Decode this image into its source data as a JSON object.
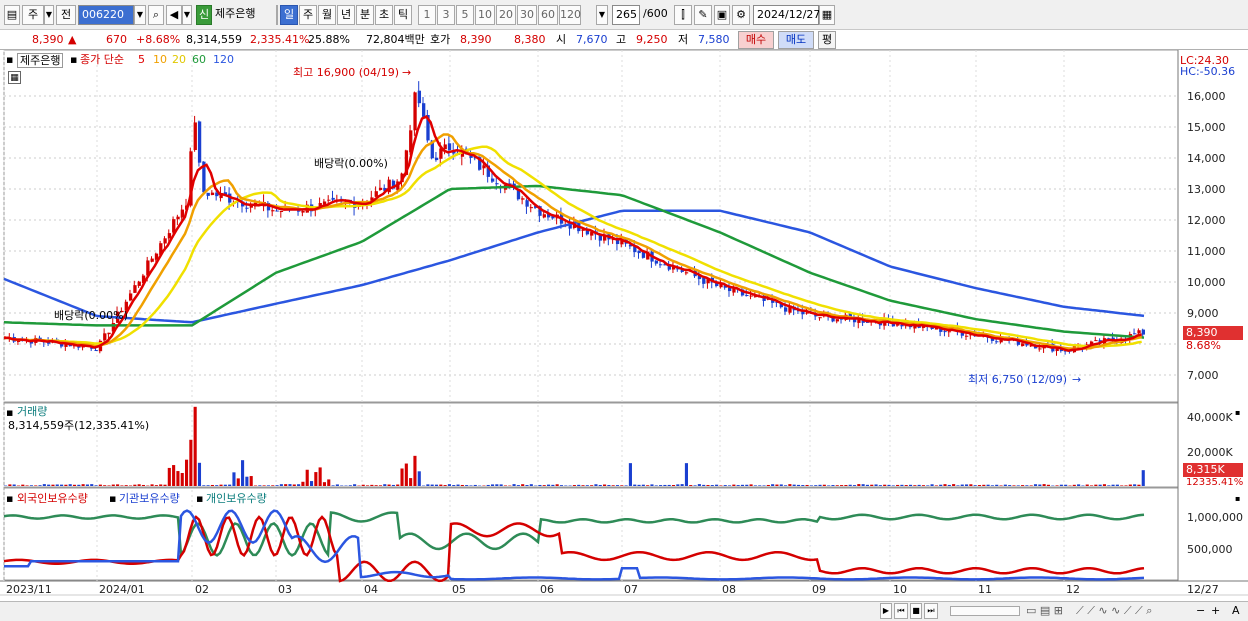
{
  "toolbar": {
    "type_label": "주",
    "prev_label": "전",
    "stock_code": "006220",
    "badge": "신",
    "stock_name": "제주은행",
    "periods": [
      "일",
      "주",
      "월",
      "년",
      "분",
      "초",
      "틱"
    ],
    "selected_period": "일",
    "intervals": [
      "1",
      "3",
      "5",
      "10",
      "20",
      "30",
      "60",
      "120"
    ],
    "count": "265",
    "count_total": "/600",
    "date": "2024/12/27"
  },
  "quote": {
    "price": "8,390",
    "change": "670",
    "change_pct": "+8.68%",
    "volume": "8,314,559",
    "volume_ratio": "2,335.41%",
    "turnover": "25.88%",
    "amount": "72,804백만",
    "hoga_label": "호가",
    "ask": "8,390",
    "bid": "8,380",
    "open_label": "시",
    "open": "7,670",
    "high_label": "고",
    "high": "9,250",
    "low_label": "저",
    "low": "7,580",
    "buy_label": "매수",
    "sell_label": "매도",
    "avg_label": "평"
  },
  "price_panel": {
    "name": "제주은행",
    "ma_title": "종가 단순",
    "ma_periods": [
      "5",
      "10",
      "20",
      "60",
      "120"
    ],
    "max_label": "최고 16,900 (04/19)",
    "min_label": "최저 6,750 (12/09)",
    "dividend_1": "배당락(0.00%)",
    "dividend_2": "배당락(0.00%)",
    "lc": "LC:24.30",
    "hc": "HC:-50.36",
    "current_price": "8,390",
    "current_pct": "8.68%",
    "y_ticks": [
      "16,000",
      "15,000",
      "14,000",
      "13,000",
      "12,000",
      "11,000",
      "10,000",
      "9,000",
      "7,000"
    ]
  },
  "volume_panel": {
    "title": "거래량",
    "value": "8,314,559주(12,335.41%)",
    "y_ticks": [
      "40,000K",
      "20,000K"
    ],
    "current": "8,315K",
    "current_pct": "12335.41%"
  },
  "holding_panel": {
    "series": [
      "외국인보유수량",
      "기관보유수량",
      "개인보유수량"
    ],
    "y_ticks": [
      "1,000,000",
      "500,000"
    ]
  },
  "x_axis": [
    "2023/11",
    "2024/01",
    "02",
    "03",
    "04",
    "05",
    "06",
    "07",
    "08",
    "09",
    "10",
    "11",
    "12",
    "12/27"
  ],
  "colors": {
    "ma5": "#e00000",
    "ma10": "#f0a000",
    "ma20": "#f0e000",
    "ma60": "#1f9a3a",
    "ma120": "#2b56e0",
    "up": "#d40000",
    "down": "#1a3fd0",
    "foreign": "#d40000",
    "institution": "#2b56e0",
    "individual": "#2e8b57"
  },
  "chart_data": {
    "type": "line",
    "x": [
      "2023/11",
      "2024/01",
      "02",
      "03",
      "04",
      "05",
      "06",
      "07",
      "08",
      "09",
      "10",
      "11",
      "12",
      "12/27"
    ],
    "series": [
      {
        "name": "종가",
        "values": [
          8200,
          7900,
          13000,
          12300,
          12600,
          14400,
          12300,
          11200,
          9800,
          8900,
          8700,
          8300,
          7800,
          8390
        ]
      },
      {
        "name": "120",
        "values": [
          10100,
          8900,
          8700,
          9300,
          9900,
          10700,
          11600,
          12300,
          12300,
          11600,
          10500,
          9800,
          9200,
          8900
        ]
      },
      {
        "name": "60",
        "values": [
          8700,
          8600,
          8600,
          10300,
          11300,
          13000,
          13100,
          12800,
          11600,
          10300,
          9400,
          8800,
          8400,
          8200
        ]
      }
    ],
    "max": {
      "value": 16900,
      "date": "04/19"
    },
    "min": {
      "value": 6750,
      "date": "12/09"
    },
    "ylim": [
      6500,
      16800
    ]
  }
}
